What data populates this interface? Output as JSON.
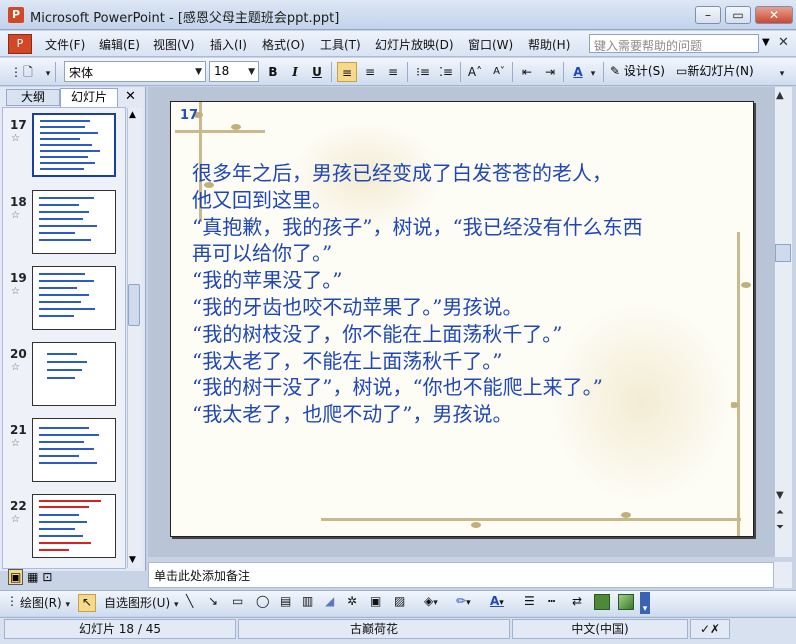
{
  "window": {
    "title": "Microsoft PowerPoint - [感恩父母主题班会ppt.ppt]",
    "app_icon": "powerpoint-icon"
  },
  "menu": {
    "items": [
      "文件(F)",
      "编辑(E)",
      "视图(V)",
      "插入(I)",
      "格式(O)",
      "工具(T)",
      "幻灯片放映(D)",
      "窗口(W)",
      "帮助(H)"
    ],
    "help_placeholder": "键入需要帮助的问题"
  },
  "toolbar": {
    "font_name": "宋体",
    "font_size": "18",
    "bold": "B",
    "italic": "I",
    "underline": "U",
    "design_label": "设计(S)",
    "new_slide_label": "新幻灯片(N)"
  },
  "left_pane": {
    "tabs": [
      "大纲",
      "幻灯片"
    ],
    "active_tab": "幻灯片",
    "thumbnails": [
      {
        "number": "17",
        "selected": true
      },
      {
        "number": "18",
        "selected": false
      },
      {
        "number": "19",
        "selected": false
      },
      {
        "number": "20",
        "selected": false
      },
      {
        "number": "21",
        "selected": false
      },
      {
        "number": "22",
        "selected": false
      }
    ]
  },
  "slide": {
    "number": "17",
    "lines": [
      "很多年之后，男孩已经变成了白发苍苍的老人，",
      "他又回到这里。",
      "“真抱歉，我的孩子”，树说，“我已经没有什么东西",
      "再可以给你了。”",
      "“我的苹果没了。”",
      "“我的牙齿也咬不动苹果了。”男孩说。",
      "“我的树枝没了，你不能在上面荡秋千了。”",
      "“我太老了，不能在上面荡秋千了。”",
      "“我的树干没了”，树说，“你也不能爬上来了。”",
      "“我太老了，也爬不动了”，男孩说。"
    ],
    "text_color": "#1f47b8"
  },
  "notes": {
    "placeholder": "单击此处添加备注"
  },
  "drawing_toolbar": {
    "draw_label": "绘图(R)",
    "autoshapes_label": "自选图形(U)"
  },
  "status": {
    "slide_position": "幻灯片 18 / 45",
    "design_name": "古巅荷花",
    "language": "中文(中国)"
  }
}
